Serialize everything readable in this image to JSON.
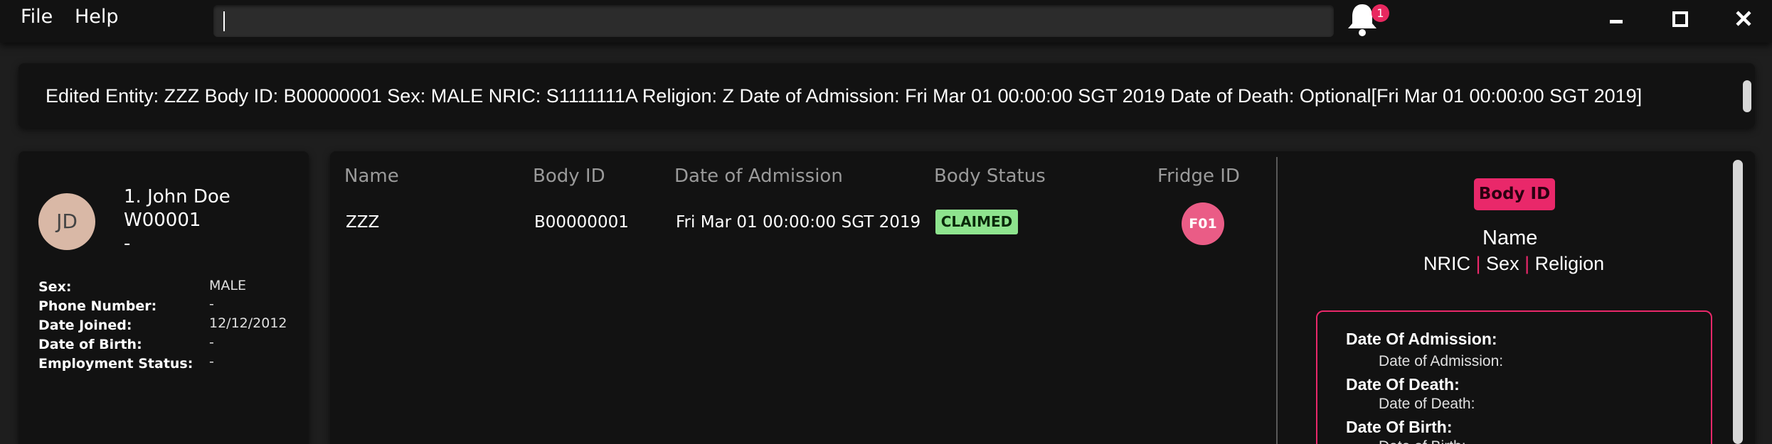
{
  "menu": {
    "file": "File",
    "help": "Help"
  },
  "command": {
    "value": ""
  },
  "notifications": {
    "count": "1"
  },
  "result": {
    "text": "Edited Entity: ZZZ Body ID: B00000001 Sex: MALE NRIC: S1111111A Religion: Z Date of Admission: Fri Mar 01 00:00:00 SGT 2019 Date of Death: Optional[Fri Mar 01 00:00:00 SGT 2019]"
  },
  "worker": {
    "initials": "JD",
    "name_line": "1. John Doe",
    "id_line": "W00001",
    "designation": "-",
    "fields": [
      {
        "label": "Sex:",
        "value": "MALE"
      },
      {
        "label": "Phone Number:",
        "value": "-"
      },
      {
        "label": "Date Joined:",
        "value": "12/12/2012"
      },
      {
        "label": "Date of Birth:",
        "value": "-"
      },
      {
        "label": "Employment Status:",
        "value": "-"
      }
    ]
  },
  "body_table": {
    "headers": [
      "Name",
      "Body ID",
      "Date of Admission",
      "Body Status",
      "Fridge ID"
    ],
    "rows": [
      {
        "name": "ZZZ",
        "body_id": "B00000001",
        "date_of_admission": "Fri Mar 01 00:00:00 SGT 2019",
        "status": "CLAIMED",
        "fridge_id": "F01"
      }
    ]
  },
  "detail": {
    "tag": "Body ID",
    "name": "Name",
    "nric": "NRIC",
    "sex": "Sex",
    "religion": "Religion",
    "separator": "|",
    "fields": [
      {
        "label": "Date Of Admission:",
        "value": "Date of Admission:"
      },
      {
        "label": "Date Of Death:",
        "value": "Date of Death:"
      },
      {
        "label": "Date Of Birth:",
        "value": "Date of Birth:"
      }
    ]
  },
  "colors": {
    "accent": "#e9286a",
    "status_claimed": "#8ee48e",
    "fridge": "#ea5c86",
    "avatar": "#d9b8a6",
    "background": "#1e1e1e",
    "panel": "#121212"
  }
}
